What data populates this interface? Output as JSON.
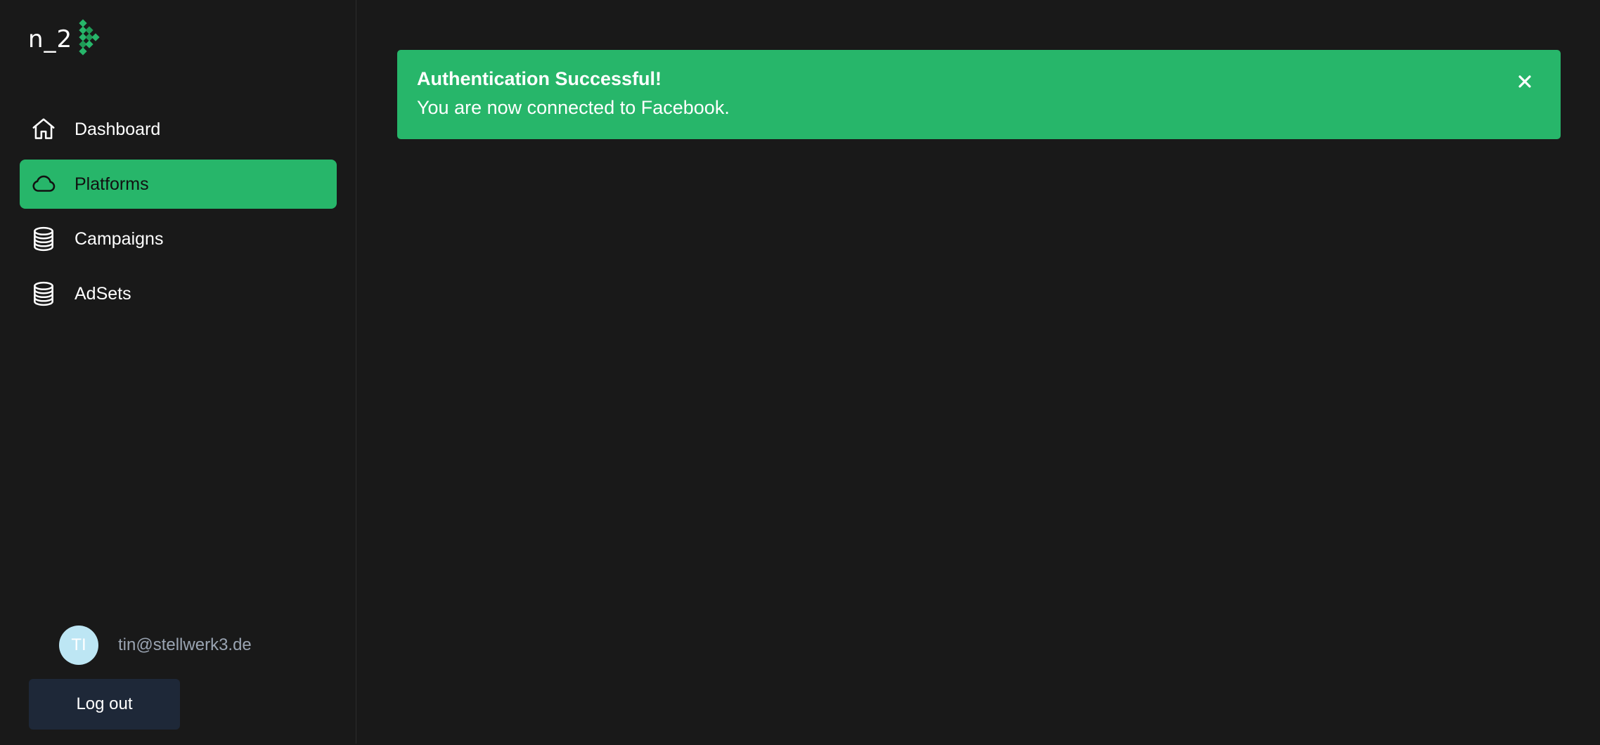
{
  "brand": {
    "logo_text": "n_2",
    "accent_color": "#27b66a"
  },
  "sidebar": {
    "items": [
      {
        "label": "Dashboard",
        "icon": "home-icon",
        "active": false
      },
      {
        "label": "Platforms",
        "icon": "cloud-icon",
        "active": true
      },
      {
        "label": "Campaigns",
        "icon": "database-icon",
        "active": false
      },
      {
        "label": "AdSets",
        "icon": "database-icon",
        "active": false
      }
    ]
  },
  "user": {
    "initials": "TI",
    "email": "tin@stellwerk3.de",
    "avatar_color": "#bde6f4"
  },
  "logout_label": "Log out",
  "alert": {
    "title": "Authentication Successful!",
    "message": "You are now connected to Facebook.",
    "close_icon": "close-icon",
    "color": "#27b66a"
  }
}
